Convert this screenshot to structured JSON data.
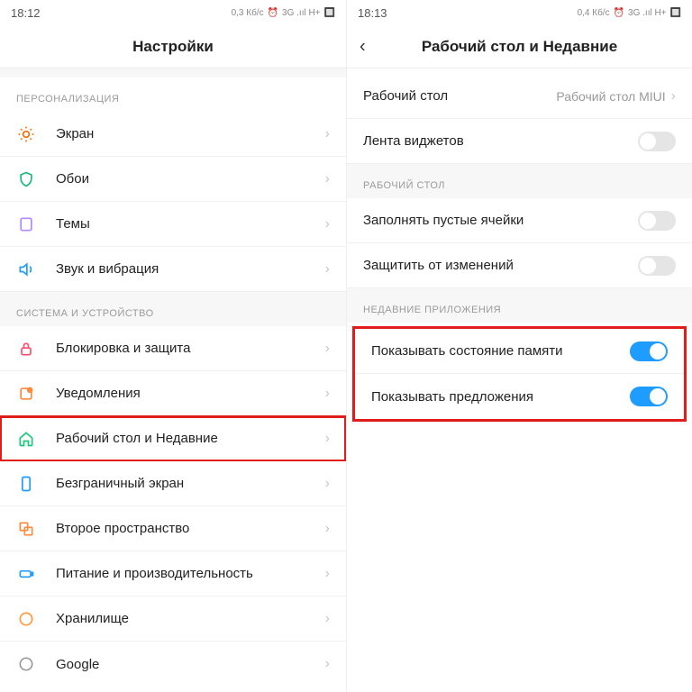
{
  "left": {
    "status": {
      "time": "18:12",
      "net": "0,3 Кб/с",
      "sig": "3G .ııl H+"
    },
    "title": "Настройки",
    "sections": [
      {
        "header": "ПЕРСОНАЛИЗАЦИЯ",
        "items": [
          {
            "label": "Экран",
            "icon": "sun",
            "color": "#ff6a00"
          },
          {
            "label": "Обои",
            "icon": "shield",
            "color": "#17b978"
          },
          {
            "label": "Темы",
            "icon": "card",
            "color": "#b388ff"
          },
          {
            "label": "Звук и вибрация",
            "icon": "sound",
            "color": "#1e9cff"
          }
        ]
      },
      {
        "header": "СИСТЕМА И УСТРОЙСТВО",
        "items": [
          {
            "label": "Блокировка и защита",
            "icon": "lock",
            "color": "#ff4d6a"
          },
          {
            "label": "Уведомления",
            "icon": "notif",
            "color": "#ff8a3d"
          },
          {
            "label": "Рабочий стол и Недавние",
            "icon": "home",
            "color": "#18c979",
            "highlight": true
          },
          {
            "label": "Безграничный экран",
            "icon": "phone",
            "color": "#1e9cff"
          },
          {
            "label": "Второе пространство",
            "icon": "dual",
            "color": "#ff8a3d"
          },
          {
            "label": "Питание и производительность",
            "icon": "batt",
            "color": "#1e9cff"
          },
          {
            "label": "Хранилище",
            "icon": "store",
            "color": "#ff9a3d"
          },
          {
            "label": "Google",
            "icon": "g",
            "color": "#9a9a9a"
          }
        ]
      }
    ]
  },
  "right": {
    "status": {
      "time": "18:13",
      "net": "0,4 Кб/с",
      "sig": "3G .ııl H+"
    },
    "title": "Рабочий стол и Недавние",
    "top": [
      {
        "label": "Рабочий стол",
        "value": "Рабочий стол MIUI"
      },
      {
        "label": "Лента виджетов",
        "toggle": false
      }
    ],
    "sections": [
      {
        "header": "РАБОЧИЙ СТОЛ",
        "items": [
          {
            "label": "Заполнять пустые ячейки",
            "toggle": false
          },
          {
            "label": "Защитить от изменений",
            "toggle": false
          }
        ]
      },
      {
        "header": "НЕДАВНИЕ ПРИЛОЖЕНИЯ",
        "items": [
          {
            "label": "Показывать состояние памяти",
            "toggle": true
          },
          {
            "label": "Показывать предложения",
            "toggle": true,
            "highlight": true
          }
        ]
      }
    ]
  }
}
